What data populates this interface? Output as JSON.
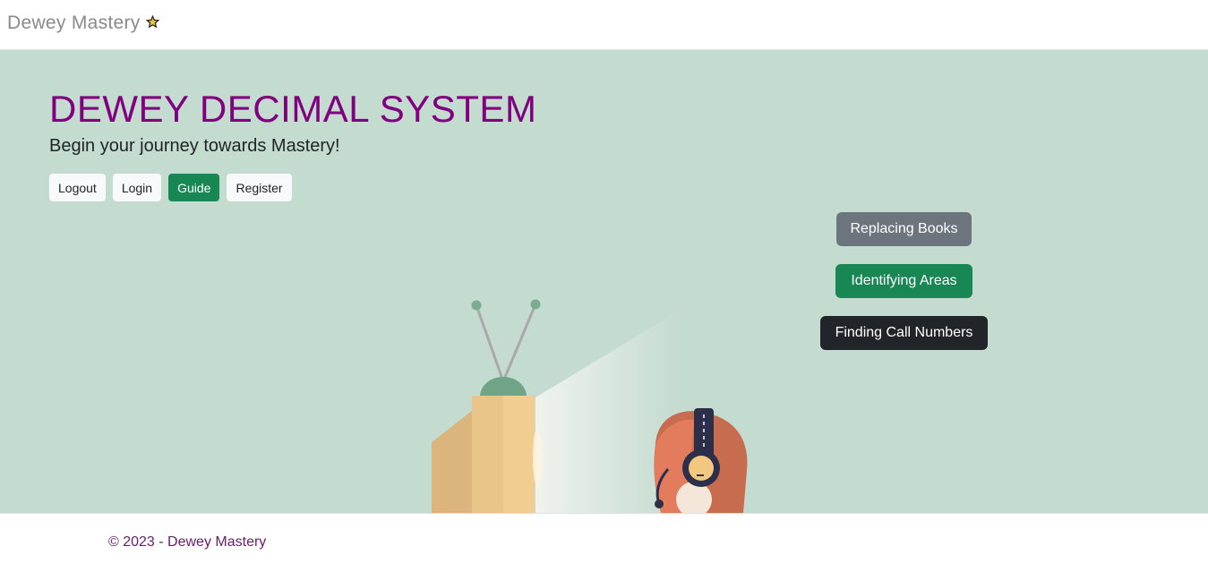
{
  "navbar": {
    "brand": "Dewey Mastery",
    "brand_icon": "star-icon"
  },
  "hero": {
    "title": "DEWEY DECIMAL SYSTEM",
    "subtitle": "Begin your journey towards Mastery!",
    "auth_buttons": {
      "logout": "Logout",
      "login": "Login",
      "guide": "Guide",
      "register": "Register"
    },
    "task_buttons": {
      "replacing_books": "Replacing Books",
      "identifying_areas": "Identifying Areas",
      "finding_call_numbers": "Finding Call Numbers"
    }
  },
  "footer": {
    "text": "© 2023 - Dewey Mastery"
  },
  "colors": {
    "hero_bg": "#c4dbd0",
    "title": "#800080",
    "success": "#198754",
    "secondary": "#6c757d",
    "dark": "#212529"
  }
}
